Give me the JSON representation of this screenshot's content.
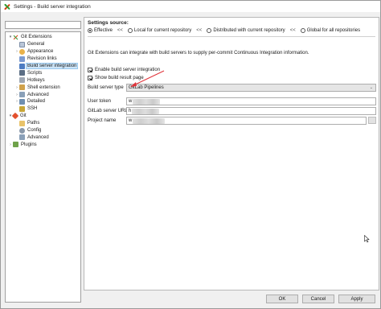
{
  "window": {
    "title": "Settings - Build server integration"
  },
  "filter": {
    "value": ""
  },
  "tree": {
    "items": [
      {
        "label": "Git Extensions",
        "expander": "▾",
        "icon": "git-extensions-icon"
      },
      {
        "label": "General",
        "expander": "",
        "icon": "general-icon"
      },
      {
        "label": "Appearance",
        "expander": "›",
        "icon": "appearance-icon"
      },
      {
        "label": "Revision links",
        "expander": "",
        "icon": "revision-links-icon"
      },
      {
        "label": "Build server integration",
        "expander": "",
        "icon": "build-server-icon"
      },
      {
        "label": "Scripts",
        "expander": "",
        "icon": "scripts-icon"
      },
      {
        "label": "Hotkeys",
        "expander": "",
        "icon": "hotkeys-icon"
      },
      {
        "label": "Shell extension",
        "expander": "›",
        "icon": "shell-extension-icon"
      },
      {
        "label": "Advanced",
        "expander": "›",
        "icon": "advanced-icon"
      },
      {
        "label": "Detailed",
        "expander": "›",
        "icon": "detailed-icon"
      },
      {
        "label": "SSH",
        "expander": "",
        "icon": "ssh-icon"
      },
      {
        "label": "Git",
        "expander": "▾",
        "icon": "git-icon"
      },
      {
        "label": "Paths",
        "expander": "",
        "icon": "paths-icon"
      },
      {
        "label": "Config",
        "expander": "",
        "icon": "config-icon"
      },
      {
        "label": "Advanced",
        "expander": "",
        "icon": "advanced-icon"
      },
      {
        "label": "Plugins",
        "expander": "›",
        "icon": "plugins-icon"
      }
    ],
    "selected_index": 4
  },
  "settings_source": {
    "label": "Settings source:",
    "options": [
      {
        "label": "Effective",
        "checked": true
      },
      {
        "label": "Local for current repository",
        "checked": false
      },
      {
        "label": "Distributed with current repository",
        "checked": false
      },
      {
        "label": "Global for all repositories",
        "checked": false
      }
    ],
    "separator": "<<"
  },
  "info_text": "Git Extensions can integrate with build servers to supply per-commit Continuous Integration information.",
  "enable_build": {
    "label": "Enable build server integration",
    "checked": true
  },
  "show_result": {
    "label": "Show build result page",
    "checked": true
  },
  "build_server_type": {
    "label": "Build server type",
    "value": "GitLab Pipelines"
  },
  "user_token": {
    "label": "User token",
    "value": "w"
  },
  "gitlab_url": {
    "label": "GitLab server URL",
    "value": "h"
  },
  "project_name": {
    "label": "Project name",
    "value": "w"
  },
  "buttons": {
    "ok": "OK",
    "cancel": "Cancel",
    "apply": "Apply"
  },
  "colors": {
    "selection": "#cce4f7",
    "annotation_arrow": "#e0333a"
  }
}
